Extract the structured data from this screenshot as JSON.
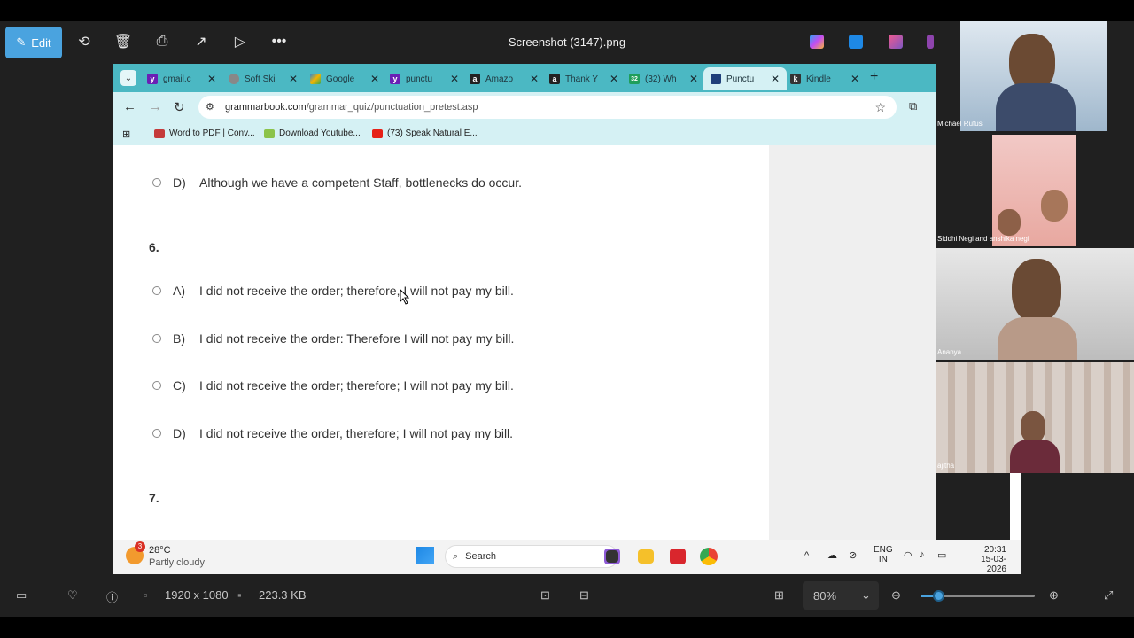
{
  "viewer": {
    "title": "Screenshot (3147).png",
    "edit_label": "Edit",
    "image_dims": "1920 x 1080",
    "file_size": "223.3 KB",
    "zoom": "80%",
    "zoom_fraction": 0.16
  },
  "browser": {
    "tabs": [
      {
        "label": "gmail.c",
        "favicon": "Y",
        "color": "#6a1fb5"
      },
      {
        "label": "Soft Ski",
        "favicon": "globe",
        "color": "#777777"
      },
      {
        "label": "Google",
        "favicon": "drive",
        "color": "#f4b400"
      },
      {
        "label": "punctu",
        "favicon": "Y",
        "color": "#6a1fb5"
      },
      {
        "label": "Amazo",
        "favicon": "a",
        "color": "#222222"
      },
      {
        "label": "Thank Y",
        "favicon": "a",
        "color": "#222222"
      },
      {
        "label": "(32) Wh",
        "favicon": "32",
        "color": "#1f9e5a"
      },
      {
        "label": "Punctu",
        "favicon": "doc",
        "color": "#1f3f7a",
        "active": true
      },
      {
        "label": "Kindle",
        "favicon": "k",
        "color": "#333333"
      }
    ],
    "url_domain": "grammarbook.com",
    "url_path": "/grammar_quiz/punctuation_pretest.asp",
    "bookmarks": [
      {
        "label": "Word to PDF | Conv...",
        "color": "#c43a3a"
      },
      {
        "label": "Download Youtube...",
        "color": "#8bc34a"
      },
      {
        "label": "(73) Speak Natural E...",
        "color": "#e62117"
      }
    ]
  },
  "quiz": {
    "prev_option": {
      "letter": "D)",
      "text": "Although we have a competent Staff, bottlenecks do occur."
    },
    "q6_number": "6.",
    "q6_options": [
      {
        "letter": "A)",
        "text": "I did not receive the order; therefore, I will not pay my bill."
      },
      {
        "letter": "B)",
        "text": "I did not receive the order: Therefore I will not pay my bill."
      },
      {
        "letter": "C)",
        "text": "I did not receive the order; therefore; I will not pay my bill."
      },
      {
        "letter": "D)",
        "text": "I did not receive the order, therefore; I will not pay my bill."
      }
    ],
    "q7_number": "7."
  },
  "taskbar": {
    "weather_temp": "28°C",
    "weather_desc": "Partly cloudy",
    "weather_badge": "3",
    "search_label": "Search",
    "lang_top": "ENG",
    "lang_bottom": "IN",
    "time": "20:31",
    "date": "15-03-2026"
  },
  "participants": [
    {
      "name": "Michael Rufus"
    },
    {
      "name": "Siddhi Negi and anshika negi"
    },
    {
      "name": "Ananya"
    },
    {
      "name": "ajitha"
    }
  ]
}
